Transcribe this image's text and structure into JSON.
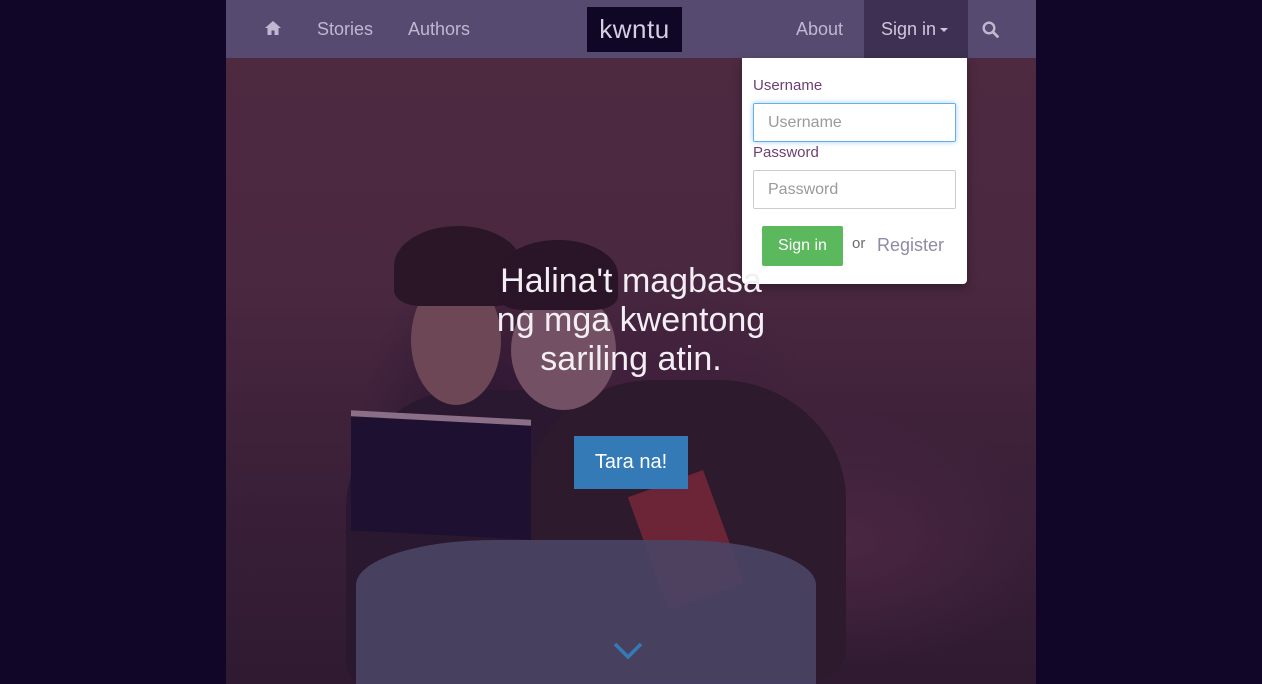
{
  "nav": {
    "home_icon": "home-icon",
    "stories": "Stories",
    "authors": "Authors",
    "brand": "kwntu",
    "about": "About",
    "signin": "Sign in",
    "search_icon": "search-icon"
  },
  "signin_form": {
    "username_label": "Username",
    "username_placeholder": "Username",
    "password_label": "Password",
    "password_placeholder": "Password",
    "submit_label": "Sign in",
    "or_text": "or",
    "register_label": "Register"
  },
  "hero": {
    "line1": "Halina't magbasa",
    "line2": "ng mga kwentong",
    "line3": "sariling atin.",
    "cta_label": "Tara na!",
    "scroll_icon": "chevron-down-icon"
  },
  "colors": {
    "background": "#110627",
    "navbar": "#574a70",
    "accent_blue": "#337ab7",
    "success_green": "#5cb85c"
  }
}
